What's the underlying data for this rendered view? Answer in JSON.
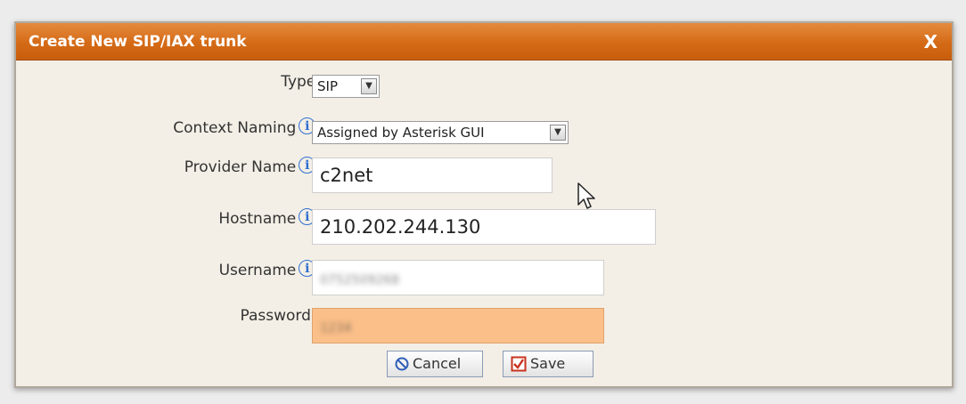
{
  "dialog": {
    "title": "Create New SIP/IAX trunk",
    "close_label": "X"
  },
  "form": {
    "type": {
      "label": "Type:",
      "value": "SIP"
    },
    "context_naming": {
      "label": "Context Naming",
      "colon": ":",
      "value": "Assigned by Asterisk GUI"
    },
    "provider_name": {
      "label": "Provider Name",
      "colon": ":",
      "value": "c2net"
    },
    "hostname": {
      "label": "Hostname",
      "colon": ":",
      "value": "210.202.244.130"
    },
    "username": {
      "label": "Username",
      "colon": ":",
      "value": "0752509268"
    },
    "password": {
      "label": "Password :",
      "value": "1234"
    }
  },
  "buttons": {
    "cancel_label": "Cancel",
    "save_label": "Save"
  },
  "info_icon_glyph": "i",
  "colors": {
    "titlebar": "#d56a16",
    "password_highlight": "#fbc08a",
    "info_icon": "#2f6fd0",
    "cancel_icon": "#2f5db8",
    "save_icon": "#c8321f"
  }
}
